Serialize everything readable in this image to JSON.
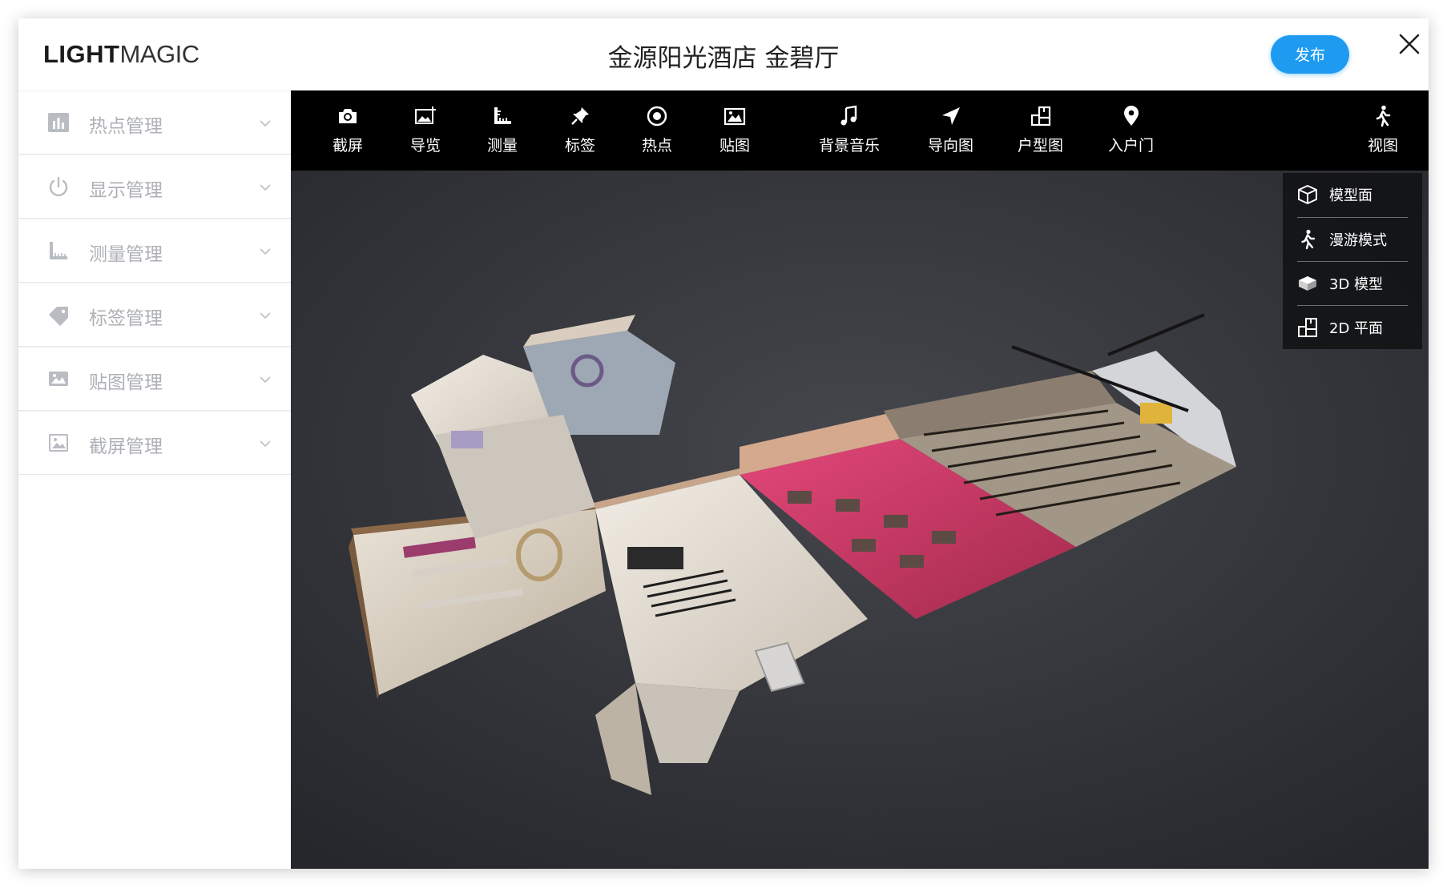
{
  "header": {
    "logo_bold": "LIGHT",
    "logo_thin": "MAGIC",
    "title": "金源阳光酒店 金碧厅",
    "publish_label": "发布"
  },
  "sidebar": {
    "items": [
      {
        "label": "热点管理",
        "icon": "bar-chart-icon"
      },
      {
        "label": "显示管理",
        "icon": "power-icon"
      },
      {
        "label": "测量管理",
        "icon": "ruler-icon"
      },
      {
        "label": "标签管理",
        "icon": "tag-icon"
      },
      {
        "label": "贴图管理",
        "icon": "image-icon"
      },
      {
        "label": "截屏管理",
        "icon": "picture-icon"
      }
    ]
  },
  "toolbar": {
    "items": [
      {
        "label": "截屏",
        "icon": "camera-icon"
      },
      {
        "label": "导览",
        "icon": "image-add-icon"
      },
      {
        "label": "测量",
        "icon": "ruler-icon"
      },
      {
        "label": "标签",
        "icon": "pin-icon"
      },
      {
        "label": "热点",
        "icon": "target-icon"
      },
      {
        "label": "贴图",
        "icon": "image-icon"
      },
      {
        "label": "背景音乐",
        "icon": "music-icon"
      },
      {
        "label": "导向图",
        "icon": "navigation-icon"
      },
      {
        "label": "户型图",
        "icon": "floorplan-icon"
      },
      {
        "label": "入户门",
        "icon": "location-pin-icon"
      }
    ],
    "view": {
      "label": "视图",
      "icon": "walk-icon"
    }
  },
  "view_menu": {
    "items": [
      {
        "label": "模型面",
        "icon": "cube-icon"
      },
      {
        "label": "漫游模式",
        "icon": "walk-icon"
      },
      {
        "label": "3D 模型",
        "icon": "3d-box-icon"
      },
      {
        "label": "2D 平面",
        "icon": "floorplan-icon"
      }
    ]
  },
  "colors": {
    "accent": "#1e9bf0",
    "toolbar_bg": "#000000",
    "viewport_bg": "#2b2d33",
    "sidebar_text": "#aeb1b6"
  }
}
